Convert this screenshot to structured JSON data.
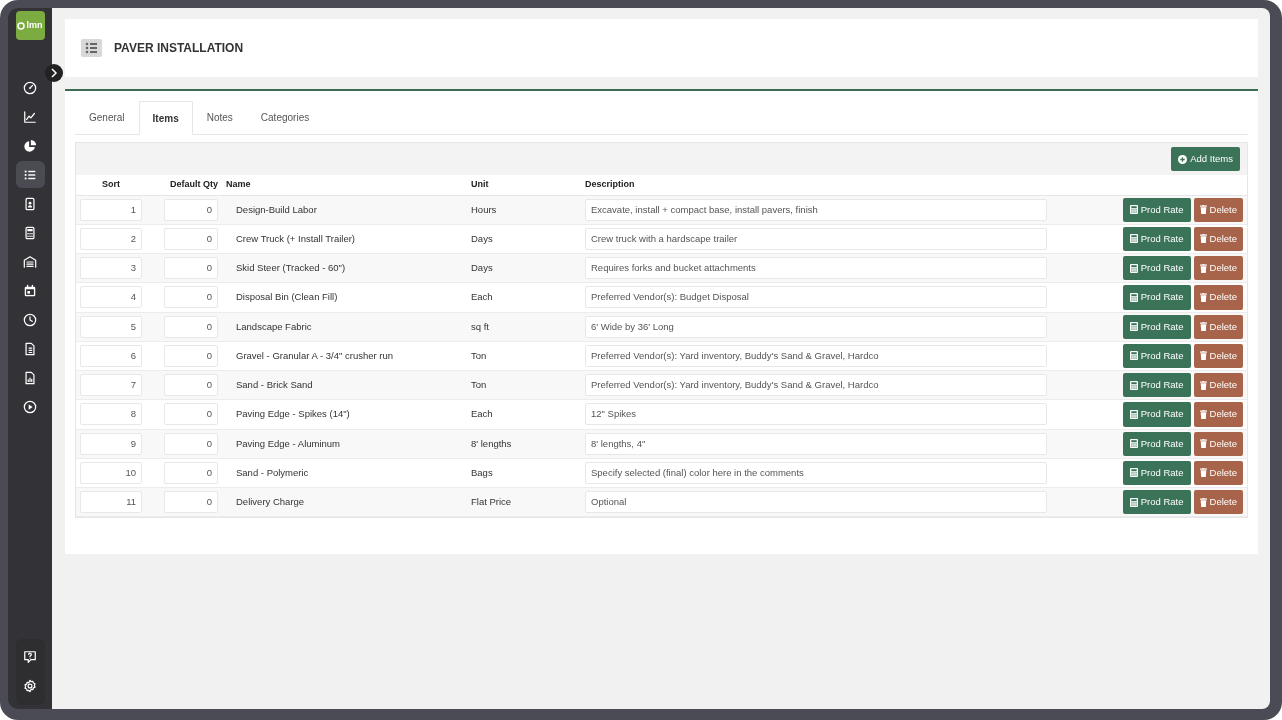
{
  "app": {
    "logo": "lmn"
  },
  "sidebar": {
    "items": [
      {
        "selected": false
      },
      {
        "selected": false
      },
      {
        "selected": false
      },
      {
        "selected": true
      },
      {
        "selected": false
      },
      {
        "selected": false
      },
      {
        "selected": false
      },
      {
        "selected": false
      },
      {
        "selected": false
      },
      {
        "selected": false
      },
      {
        "selected": false
      },
      {
        "selected": false
      }
    ]
  },
  "page": {
    "title": "PAVER INSTALLATION"
  },
  "tabs": [
    {
      "label": "General",
      "selected": false
    },
    {
      "label": "Items",
      "selected": true
    },
    {
      "label": "Notes",
      "selected": false
    },
    {
      "label": "Categories",
      "selected": false
    }
  ],
  "toolbar": {
    "add_button": "Add Items"
  },
  "table": {
    "columns": [
      "Sort",
      "Default Qty",
      "Name",
      "Unit",
      "Description"
    ],
    "rows": [
      {
        "sort": "1",
        "qty": "0",
        "name": "Design-Build Labor",
        "unit": "Hours",
        "description": "Excavate, install + compact base, install pavers, finish",
        "prod_rate": "Prod Rate",
        "delete": "Delete"
      },
      {
        "sort": "2",
        "qty": "0",
        "name": "Crew Truck (+ Install Trailer)",
        "unit": "Days",
        "description": "Crew truck with a hardscape trailer",
        "prod_rate": "Prod Rate",
        "delete": "Delete"
      },
      {
        "sort": "3",
        "qty": "0",
        "name": "Skid Steer (Tracked - 60\")",
        "unit": "Days",
        "description": "Requires forks and bucket attachments",
        "prod_rate": "Prod Rate",
        "delete": "Delete"
      },
      {
        "sort": "4",
        "qty": "0",
        "name": "Disposal Bin (Clean Fill)",
        "unit": "Each",
        "description": "Preferred Vendor(s):  Budget Disposal",
        "prod_rate": "Prod Rate",
        "delete": "Delete"
      },
      {
        "sort": "5",
        "qty": "0",
        "name": "Landscape Fabric",
        "unit": "sq ft",
        "description": "6' Wide by 36' Long",
        "prod_rate": "Prod Rate",
        "delete": "Delete"
      },
      {
        "sort": "6",
        "qty": "0",
        "name": "Gravel - Granular A - 3/4\" crusher run",
        "unit": "Ton",
        "description": "Preferred Vendor(s):  Yard inventory, Buddy's Sand & Gravel, Hardco",
        "prod_rate": "Prod Rate",
        "delete": "Delete"
      },
      {
        "sort": "7",
        "qty": "0",
        "name": "Sand - Brick Sand",
        "unit": "Ton",
        "description": "Preferred Vendor(s):  Yard inventory, Buddy's Sand & Gravel, Hardco",
        "prod_rate": "Prod Rate",
        "delete": "Delete"
      },
      {
        "sort": "8",
        "qty": "0",
        "name": "Paving Edge - Spikes (14\")",
        "unit": "Each",
        "description": "12\" Spikes",
        "prod_rate": "Prod Rate",
        "delete": "Delete"
      },
      {
        "sort": "9",
        "qty": "0",
        "name": "Paving Edge - Aluminum",
        "unit": "8' lengths",
        "description": "8' lengths, 4\"",
        "prod_rate": "Prod Rate",
        "delete": "Delete"
      },
      {
        "sort": "10",
        "qty": "0",
        "name": "Sand - Polymeric",
        "unit": "Bags",
        "description": "Specify selected (final) color here in the comments",
        "prod_rate": "Prod Rate",
        "delete": "Delete"
      },
      {
        "sort": "11",
        "qty": "0",
        "name": "Delivery Charge",
        "unit": "Flat Price",
        "description": "Optional",
        "prod_rate": "Prod Rate",
        "delete": "Delete"
      }
    ]
  }
}
